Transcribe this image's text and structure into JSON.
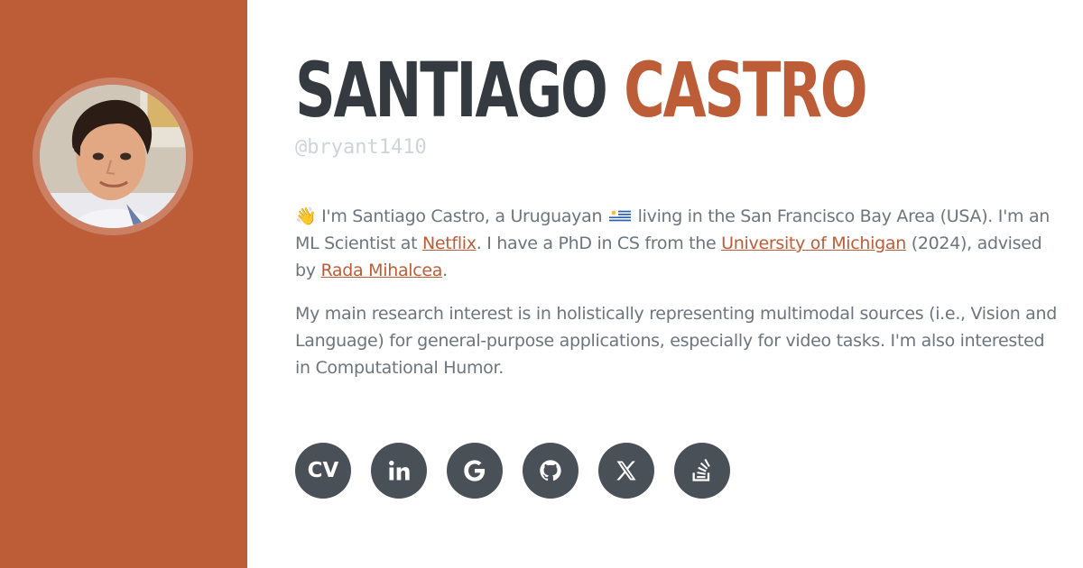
{
  "colors": {
    "accent": "#bd5d38",
    "dark": "#343a40",
    "muted_text": "#6c757d",
    "handle": "#ced4da",
    "button_bg": "#495057"
  },
  "profile": {
    "first_name": "SANTIAGO",
    "last_name": "CASTRO",
    "handle": "@bryant1410"
  },
  "bio": {
    "p1": {
      "wave": "👋",
      "t1": " I'm Santiago Castro, a Uruguayan ",
      "flag_icon": "uruguay-flag-icon",
      "t2": " living in the San Francisco Bay Area (USA). I'm an ML Scientist at ",
      "link_netflix": "Netflix",
      "t3": ". I have a PhD in CS from the ",
      "link_umich": "University of Michigan",
      "t4": " (2024), advised by ",
      "link_rada": "Rada Mihalcea",
      "t5": "."
    },
    "p2": "My main research interest is in holistically representing multimodal sources (i.e., Vision and Language) for general-purpose applications, especially for video tasks. I'm also interested in Computational Humor."
  },
  "social": {
    "cv_label": "CV",
    "icons": [
      "cv-icon",
      "linkedin-icon",
      "google-scholar-icon",
      "github-icon",
      "x-icon",
      "stack-overflow-icon"
    ]
  }
}
